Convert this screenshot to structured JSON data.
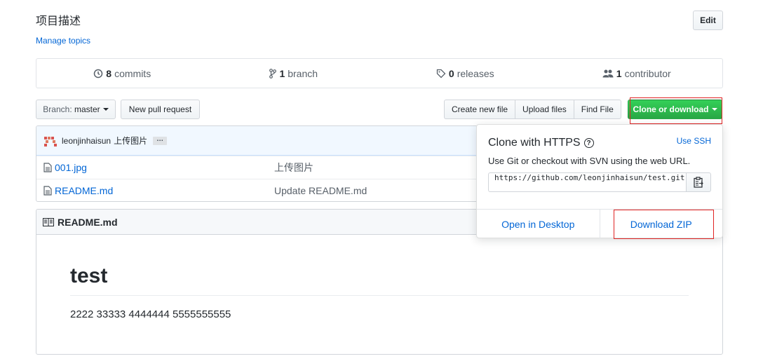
{
  "repo": {
    "description": "项目描述",
    "manage_topics": "Manage topics",
    "edit_label": "Edit"
  },
  "summary": {
    "commits_count": "8",
    "commits_label": "commits",
    "branch_count": "1",
    "branch_label": "branch",
    "releases_count": "0",
    "releases_label": "releases",
    "contributor_count": "1",
    "contributor_label": "contributor"
  },
  "toolbar": {
    "branch_prefix": "Branch:",
    "branch_name": "master",
    "new_pr": "New pull request",
    "create_file": "Create new file",
    "upload_files": "Upload files",
    "find_file": "Find File",
    "clone_download": "Clone or download"
  },
  "commit": {
    "author": "leonjinhaisun",
    "message": "上传图片",
    "ellipsis": "…"
  },
  "files": [
    {
      "name": "001.jpg",
      "message": "上传图片"
    },
    {
      "name": "README.md",
      "message": "Update README.md"
    }
  ],
  "readme": {
    "filename": "README.md",
    "heading": "test",
    "body": "2222 33333 4444444 5555555555"
  },
  "clone_dropdown": {
    "title": "Clone with HTTPS",
    "help": "?",
    "use_ssh": "Use SSH",
    "description": "Use Git or checkout with SVN using the web URL.",
    "url": "https://github.com/leonjinhaisun/test.git",
    "open_desktop": "Open in Desktop",
    "download_zip": "Download ZIP"
  },
  "colors": {
    "link": "#0366d6",
    "primary_green": "#28a745",
    "highlight_red": "#e02424"
  }
}
